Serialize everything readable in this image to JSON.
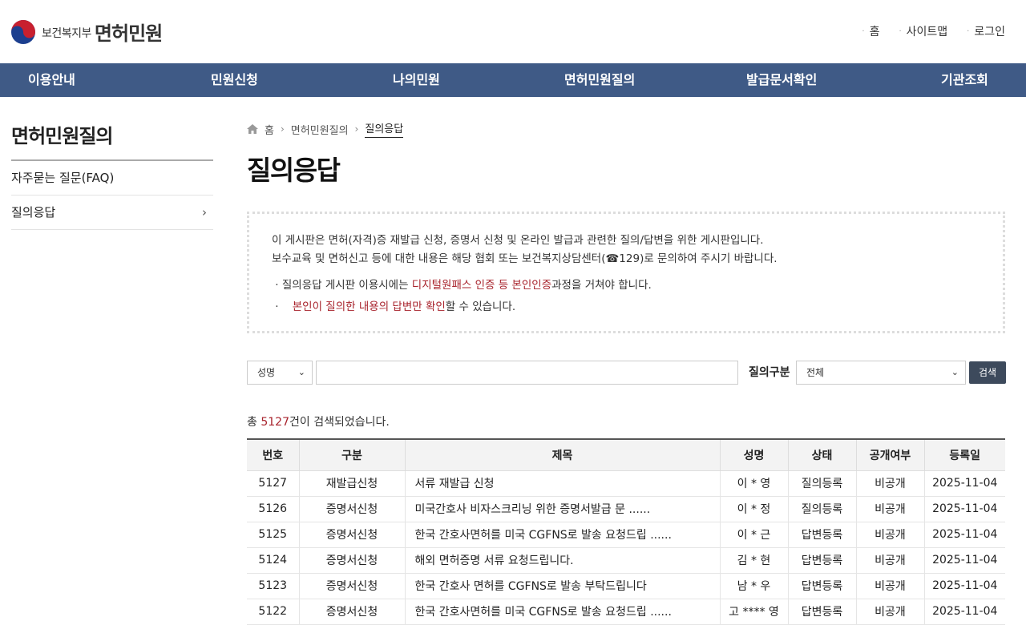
{
  "header": {
    "ministry": "보건복지부",
    "site_name": "면허민원",
    "util_links": [
      "홈",
      "사이트맵",
      "로그인"
    ]
  },
  "gnb": [
    "이용안내",
    "민원신청",
    "나의민원",
    "면허민원질의",
    "발급문서확인",
    "기관조회"
  ],
  "lnb": {
    "title": "면허민원질의",
    "items": [
      "자주묻는 질문(FAQ)",
      "질의응답"
    ]
  },
  "breadcrumb": [
    "홈",
    "면허민원질의",
    "질의응답"
  ],
  "page_title": "질의응답",
  "notice": {
    "line1": "이 게시판은 면허(자격)증 재발급 신청, 증명서 신청 및 온라인 발급과 관련한 질의/답변을 위한 게시판입니다.",
    "line2": "보수교육 및 면허신고 등에 대한 내용은 해당 협회 또는 보건복지상담센터(☎129)로 문의하여 주시기 바랍니다.",
    "bullet1_pre": "질의응답 게시판 이용시에는 ",
    "bullet1_red": "디지털원패스 인증 등 본인인증",
    "bullet1_post": "과정을 거쳐야 합니다.",
    "bullet2_red": "본인이 질의한 내용의 답변만 확인",
    "bullet2_post": "할 수 있습니다."
  },
  "search": {
    "field_select": "성명",
    "keyword": "",
    "category_label": "질의구분",
    "category_select": "전체",
    "button": "검색"
  },
  "result": {
    "pre": "총 ",
    "count": "5127",
    "post": "건이 검색되었습니다."
  },
  "table": {
    "headers": [
      "번호",
      "구분",
      "제목",
      "성명",
      "상태",
      "공개여부",
      "등록일"
    ],
    "rows": [
      [
        "5127",
        "재발급신청",
        "서류 재발급 신청",
        "이 * 영",
        "질의등록",
        "비공개",
        "2025-11-04"
      ],
      [
        "5126",
        "증명서신청",
        "미국간호사 비자스크리닝 위한 증명서발급 문 ......",
        "이 * 정",
        "질의등록",
        "비공개",
        "2025-11-04"
      ],
      [
        "5125",
        "증명서신청",
        "한국 간호사면허를 미국 CGFNS로 발송 요청드립 ......",
        "이 * 근",
        "답변등록",
        "비공개",
        "2025-11-04"
      ],
      [
        "5124",
        "증명서신청",
        "해외 면허증명 서류 요청드립니다.",
        "김 * 현",
        "답변등록",
        "비공개",
        "2025-11-04"
      ],
      [
        "5123",
        "증명서신청",
        "한국 간호사 면허를 CGFNS로 발송 부탁드립니다",
        "남 * 우",
        "답변등록",
        "비공개",
        "2025-11-04"
      ],
      [
        "5122",
        "증명서신청",
        "한국 간호사면허를 미국 CGFNS로 발송 요청드립 ......",
        "고 **** 영",
        "답변등록",
        "비공개",
        "2025-11-04"
      ]
    ]
  },
  "colors": {
    "nav_bg": "#3f5a86",
    "accent_red": "#a8232c",
    "button_bg": "#3d4a5c"
  }
}
